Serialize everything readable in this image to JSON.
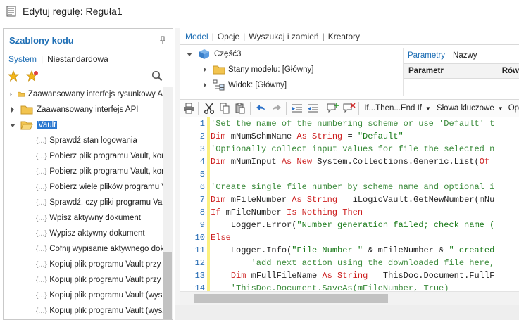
{
  "window": {
    "title": "Edytuj regułę: Reguła1"
  },
  "left_panel": {
    "title": "Szablony kodu",
    "tabs": [
      {
        "label": "System",
        "active": true
      },
      {
        "label": "Niestandardowa",
        "active": false
      }
    ],
    "tree": [
      {
        "type": "folder",
        "label": "Zaawansowany interfejs rysunkowy A",
        "expanded": false
      },
      {
        "type": "folder",
        "label": "Zaawansowany interfejs API",
        "expanded": false
      },
      {
        "type": "folder",
        "label": "Vault",
        "expanded": true,
        "selected": true
      },
      {
        "type": "snippet",
        "label": "Sprawdź stan logowania"
      },
      {
        "type": "snippet",
        "label": "Pobierz plik programu Vault, korz"
      },
      {
        "type": "snippet",
        "label": "Pobierz plik programu Vault, korz"
      },
      {
        "type": "snippet",
        "label": "Pobierz wiele plików programu Vau"
      },
      {
        "type": "snippet",
        "label": "Sprawdź, czy pliki programu Vault"
      },
      {
        "type": "snippet",
        "label": "Wpisz aktywny dokument"
      },
      {
        "type": "snippet",
        "label": "Wypisz aktywny dokument"
      },
      {
        "type": "snippet",
        "label": "Cofnij wypisanie aktywnego doku"
      },
      {
        "type": "snippet",
        "label": "Kopiuj plik programu Vault przy u"
      },
      {
        "type": "snippet",
        "label": "Kopiuj plik programu Vault przy u"
      },
      {
        "type": "snippet",
        "label": "Kopiuj plik programu Vault (wyszu"
      },
      {
        "type": "snippet",
        "label": "Kopiuj plik programu Vault (wyszu"
      }
    ],
    "snippet_glyph": "{…}"
  },
  "right_tabs": [
    {
      "label": "Model",
      "active": true
    },
    {
      "label": "Opcje",
      "active": false
    },
    {
      "label": "Wyszukaj i zamień",
      "active": false
    },
    {
      "label": "Kreatory",
      "active": false
    }
  ],
  "model_tree": {
    "root": "Część3",
    "children": [
      "Stany modelu: [Główny]",
      "Widok: [Główny]"
    ]
  },
  "params": {
    "tabs": [
      {
        "label": "Parametry",
        "active": true
      },
      {
        "label": "Nazwy",
        "active": false
      }
    ],
    "columns": [
      "Parametr",
      "Rów"
    ]
  },
  "toolbar": {
    "ifthen_label": "If...Then...End If",
    "keywords_label": "Słowa kluczowe",
    "more_label": "Op"
  },
  "editor": {
    "line_numbers": [
      "1",
      "2",
      "3",
      "4",
      "5",
      "6",
      "7",
      "8",
      "9",
      "10",
      "11",
      "12",
      "13",
      "14"
    ],
    "lines": [
      [
        {
          "t": "cm",
          "s": "'Set the name of the numbering scheme or use 'Default' t"
        }
      ],
      [
        {
          "t": "kw",
          "s": "Dim"
        },
        {
          "t": "tx",
          "s": " mNumSchmName "
        },
        {
          "t": "kw",
          "s": "As String"
        },
        {
          "t": "tx",
          "s": " = "
        },
        {
          "t": "st",
          "s": "\"Default\""
        }
      ],
      [
        {
          "t": "cm",
          "s": "'Optionally collect input values for file the selected n"
        }
      ],
      [
        {
          "t": "kw",
          "s": "Dim"
        },
        {
          "t": "tx",
          "s": " mNumInput "
        },
        {
          "t": "kw",
          "s": "As New"
        },
        {
          "t": "tx",
          "s": " System.Collections.Generic.List("
        },
        {
          "t": "kw",
          "s": "Of"
        }
      ],
      [
        {
          "t": "tx",
          "s": ""
        }
      ],
      [
        {
          "t": "cm",
          "s": "'Create single file number by scheme name and optional i"
        }
      ],
      [
        {
          "t": "kw",
          "s": "Dim"
        },
        {
          "t": "tx",
          "s": " mFileNumber "
        },
        {
          "t": "kw",
          "s": "As String"
        },
        {
          "t": "tx",
          "s": " = iLogicVault.GetNewNumber(mNu"
        }
      ],
      [
        {
          "t": "kw",
          "s": "If"
        },
        {
          "t": "tx",
          "s": " mFileNumber "
        },
        {
          "t": "kw",
          "s": "Is Nothing Then"
        }
      ],
      [
        {
          "t": "tx",
          "s": "    Logger.Error("
        },
        {
          "t": "st",
          "s": "\"Number generation failed; check name ("
        }
      ],
      [
        {
          "t": "kw",
          "s": "Else"
        }
      ],
      [
        {
          "t": "tx",
          "s": "    Logger.Info("
        },
        {
          "t": "st",
          "s": "\"File Number \""
        },
        {
          "t": "tx",
          "s": " & mFileNumber & "
        },
        {
          "t": "st",
          "s": "\" created"
        }
      ],
      [
        {
          "t": "cm",
          "s": "        'add next action using the downloaded file here,"
        }
      ],
      [
        {
          "t": "tx",
          "s": "    "
        },
        {
          "t": "kw",
          "s": "Dim"
        },
        {
          "t": "tx",
          "s": " mFullFileName "
        },
        {
          "t": "kw",
          "s": "As String"
        },
        {
          "t": "tx",
          "s": " = ThisDoc.Document.FullF"
        }
      ],
      [
        {
          "t": "cm",
          "s": "    'ThisDoc.Document.SaveAs(mFileNumber, True)"
        }
      ]
    ]
  }
}
